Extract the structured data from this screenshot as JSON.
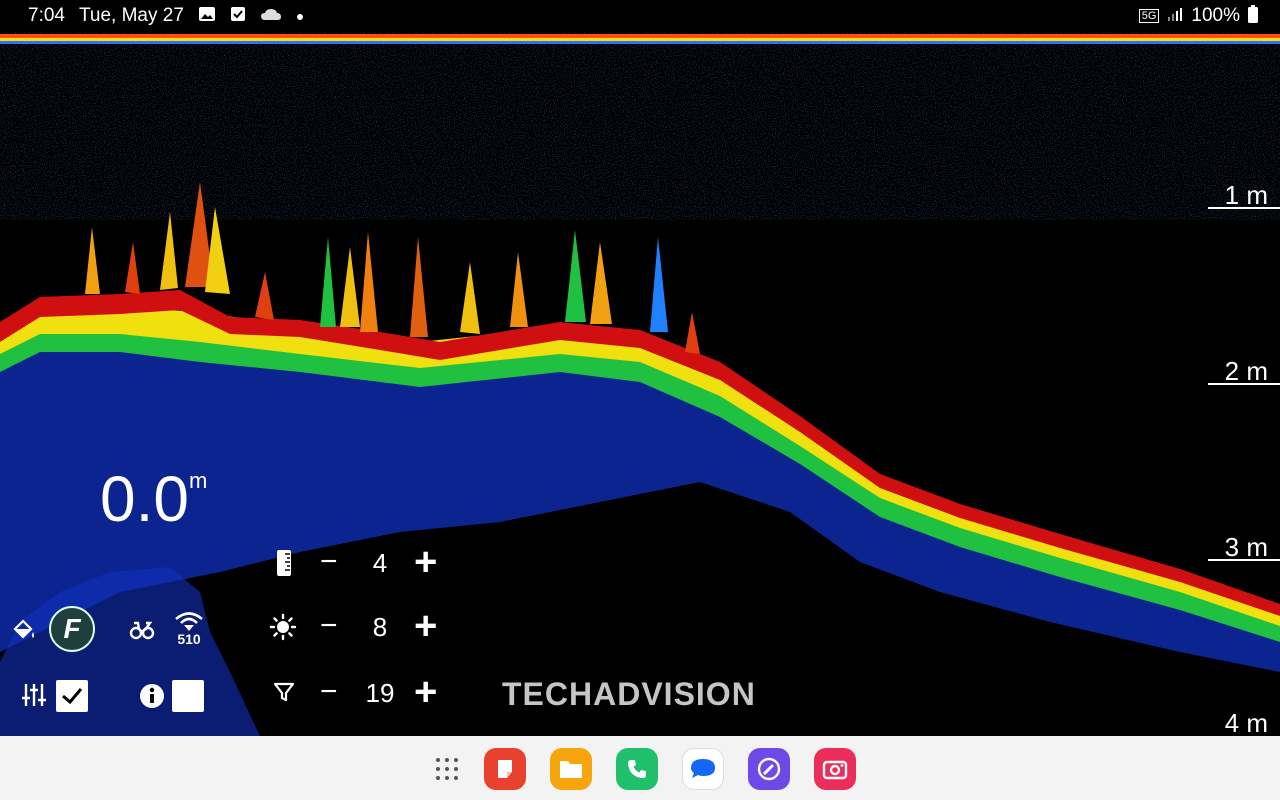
{
  "status_bar": {
    "time": "7:04",
    "date": "Tue, May 27",
    "network": "5G",
    "battery": "100%",
    "notification_icons": [
      "gallery-icon",
      "checkbox-icon",
      "cloud-icon",
      "dot-icon"
    ]
  },
  "sonar": {
    "depth_scale": [
      "1 m",
      "2 m",
      "3 m",
      "4 m"
    ],
    "current_depth": "0.0",
    "current_depth_unit": "m"
  },
  "controls": {
    "range": {
      "icon": "ruler-icon",
      "value": "4",
      "minus": "−",
      "plus": "+"
    },
    "gain": {
      "icon": "brightness-icon",
      "value": "8",
      "minus": "−",
      "plus": "+"
    },
    "filter": {
      "icon": "filter-icon",
      "value": "19",
      "minus": "−",
      "plus": "+"
    }
  },
  "left_panel": {
    "frequency_badge": "510",
    "fish_mode_letter": "F"
  },
  "watermark": "TECHADVISION",
  "dock_apps": [
    "app-drawer-icon",
    "notes-app-icon",
    "files-app-icon",
    "phone-app-icon",
    "messages-app-icon",
    "browser-app-icon",
    "camera-app-icon"
  ],
  "colors": {
    "echo_strong": "#d01010",
    "echo_mid": "#f0e010",
    "echo_green": "#20d020",
    "echo_weak": "#1040ff",
    "surface_line": "#ff7020",
    "nav_background": "#f3f3f3"
  }
}
